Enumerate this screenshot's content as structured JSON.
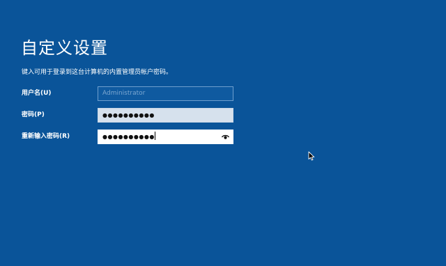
{
  "page": {
    "title": "自定义设置",
    "instructions": "键入可用于登录到这台计算机的内置管理员帐户密码。",
    "background_color": "#0a5499"
  },
  "form": {
    "username": {
      "label": "用户名(U)",
      "placeholder": "Administrator",
      "value": ""
    },
    "password": {
      "label": "密码(P)",
      "value": "●●●●●●●●●●"
    },
    "confirm_password": {
      "label": "重新输入密码(R)",
      "value": "●●●●●●●●●●",
      "reveal_icon": "eye-icon"
    }
  },
  "icons": {
    "cursor": "mouse-pointer-icon"
  }
}
